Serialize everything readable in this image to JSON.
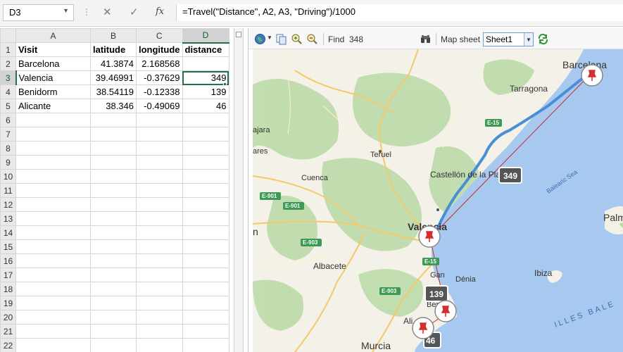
{
  "formula_bar": {
    "name_box": "D3",
    "formula": "=Travel(\"Distance\", A2, A3, \"Driving\")/1000"
  },
  "sheet": {
    "columns": [
      "A",
      "B",
      "C",
      "D"
    ],
    "selected_column": "D",
    "selected_row": "3",
    "rows": [
      {
        "n": "1",
        "cells": [
          "Visit",
          "latitude",
          "longitude",
          "distance"
        ]
      },
      {
        "n": "2",
        "cells": [
          "Barcelona",
          "41.3874",
          "2.168568",
          ""
        ]
      },
      {
        "n": "3",
        "cells": [
          "Valencia",
          "39.46991",
          "-0.37629",
          "349"
        ]
      },
      {
        "n": "4",
        "cells": [
          "Benidorm",
          "38.54119",
          "-0.12338",
          "139"
        ]
      },
      {
        "n": "5",
        "cells": [
          "Alicante",
          "38.346",
          "-0.49069",
          "46"
        ]
      },
      {
        "n": "6",
        "cells": [
          "",
          "",
          "",
          ""
        ]
      },
      {
        "n": "7",
        "cells": [
          "",
          "",
          "",
          ""
        ]
      },
      {
        "n": "8",
        "cells": [
          "",
          "",
          "",
          ""
        ]
      },
      {
        "n": "9",
        "cells": [
          "",
          "",
          "",
          ""
        ]
      },
      {
        "n": "10",
        "cells": [
          "",
          "",
          "",
          ""
        ]
      },
      {
        "n": "11",
        "cells": [
          "",
          "",
          "",
          ""
        ]
      },
      {
        "n": "12",
        "cells": [
          "",
          "",
          "",
          ""
        ]
      },
      {
        "n": "13",
        "cells": [
          "",
          "",
          "",
          ""
        ]
      },
      {
        "n": "14",
        "cells": [
          "",
          "",
          "",
          ""
        ]
      },
      {
        "n": "15",
        "cells": [
          "",
          "",
          "",
          ""
        ]
      },
      {
        "n": "16",
        "cells": [
          "",
          "",
          "",
          ""
        ]
      },
      {
        "n": "17",
        "cells": [
          "",
          "",
          "",
          ""
        ]
      },
      {
        "n": "18",
        "cells": [
          "",
          "",
          "",
          ""
        ]
      },
      {
        "n": "19",
        "cells": [
          "",
          "",
          "",
          ""
        ]
      },
      {
        "n": "20",
        "cells": [
          "",
          "",
          "",
          ""
        ]
      },
      {
        "n": "21",
        "cells": [
          "",
          "",
          "",
          ""
        ]
      },
      {
        "n": "22",
        "cells": [
          "",
          "",
          "",
          ""
        ]
      }
    ]
  },
  "map_toolbar": {
    "find_label": "Find",
    "find_value": "348",
    "map_sheet_label": "Map sheet",
    "map_sheet_value": "Sheet1"
  },
  "map": {
    "cities": [
      "Barcelona",
      "Tarragona",
      "Teruel",
      "Castellón de la Plana",
      "Cuenca",
      "Valencia",
      "Albacete",
      "Gandia",
      "Dénia",
      "Benidorm",
      "Alicante",
      "Murcia",
      "Ibiza",
      "Palma"
    ],
    "partial_labels": [
      "ajara",
      "ares",
      "n",
      "Gan",
      "Ben",
      "Ali",
      "Palm"
    ],
    "sea_labels": [
      "Balearic Sea",
      "ILLES BALE"
    ],
    "roads": [
      "E-15",
      "E-901",
      "E-903"
    ],
    "distance_badges": [
      "349",
      "139",
      "46"
    ],
    "colors": {
      "water": "#a6c8f0",
      "land": "#f5f2ea",
      "forest": "#b5d7a4",
      "route_line": "#c62828",
      "route_road": "#4a8fd6",
      "badge": "#555555",
      "accent": "#217346"
    }
  }
}
